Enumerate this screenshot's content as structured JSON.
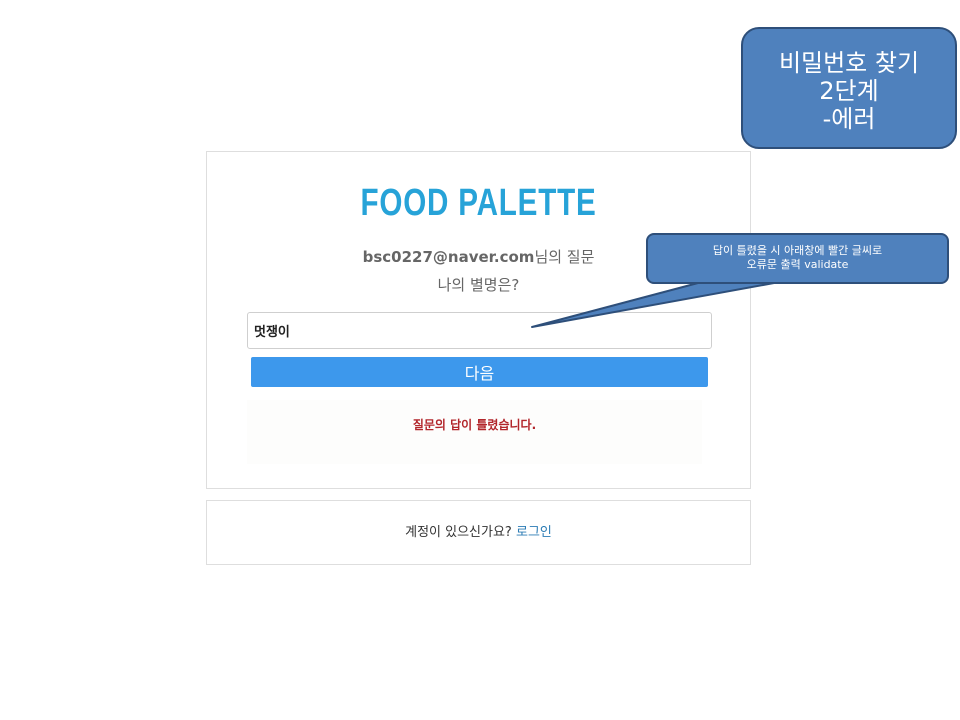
{
  "annotation": {
    "title_lines": [
      "비밀번호 찾기",
      "2단계",
      "-에러"
    ],
    "callout_lines": [
      "답이 틀렸을 시 아래창에 빨간 글씨로",
      "오류문 출력 validate"
    ],
    "color": "#4f81bd"
  },
  "card": {
    "brand": "FOOD PALETTE",
    "question_email": "bsc0227@naver.com",
    "question_suffix": "님의 질문",
    "question_text": "나의 별명은?",
    "answer_value": "멋쟁이",
    "next_label": "다음",
    "error_message": "질문의 답이 틀렸습니다.",
    "accent_color": "#3d98ec",
    "error_color": "#b2262b"
  },
  "footer": {
    "prompt": "계정이 있으신가요? ",
    "login_label": "로그인"
  }
}
